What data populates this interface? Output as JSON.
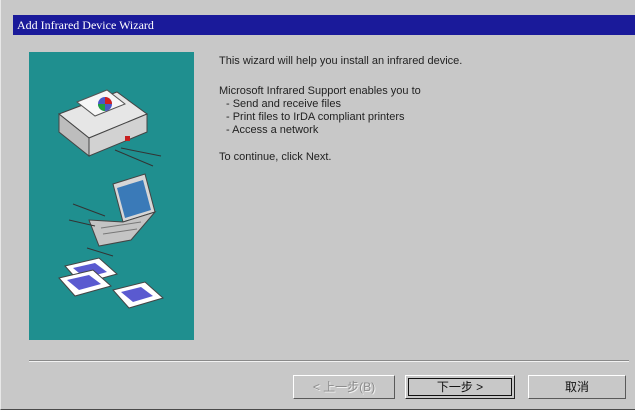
{
  "window": {
    "title": "Add Infrared Device Wizard"
  },
  "content": {
    "intro": "This wizard will help you install an infrared device.",
    "features_heading": "Microsoft Infrared Support enables you to",
    "features": [
      "- Send and receive files",
      "- Print files to IrDA compliant printers",
      "- Access a network"
    ],
    "continue_text": "To continue, click Next."
  },
  "buttons": {
    "back": "< 上一步(B)",
    "next": "下一步 >",
    "cancel": "取消"
  },
  "colors": {
    "titlebar": "#1a1a9a",
    "art_panel": "#1f8f8f",
    "dialog_face": "#c8c8c8"
  },
  "illustration": {
    "icons": [
      "printer-icon",
      "laptop-icon",
      "paper-sheets-icon"
    ]
  }
}
